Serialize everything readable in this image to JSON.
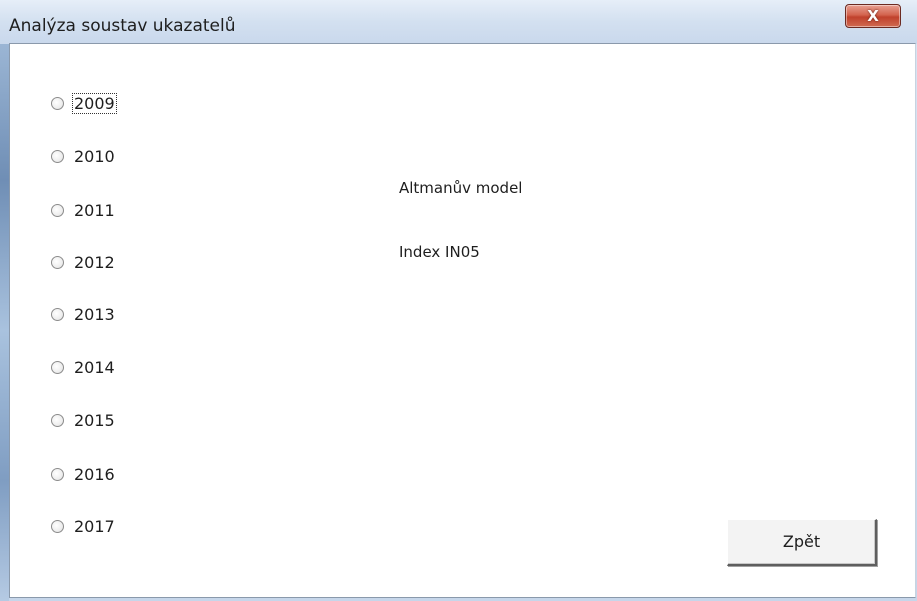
{
  "window": {
    "title": "Analýza soustav ukazatelů",
    "close_label": "X"
  },
  "years": {
    "options": [
      "2009",
      "2010",
      "2011",
      "2012",
      "2013",
      "2014",
      "2015",
      "2016",
      "2017"
    ],
    "selected": null,
    "focused": "2009"
  },
  "models": {
    "altman": "Altmanův model",
    "in05": "Index IN05"
  },
  "buttons": {
    "back": "Zpět"
  },
  "colors": {
    "close_button": "#c8523b",
    "titlebar": "#d3e0f0",
    "client_background": "#ffffff"
  }
}
